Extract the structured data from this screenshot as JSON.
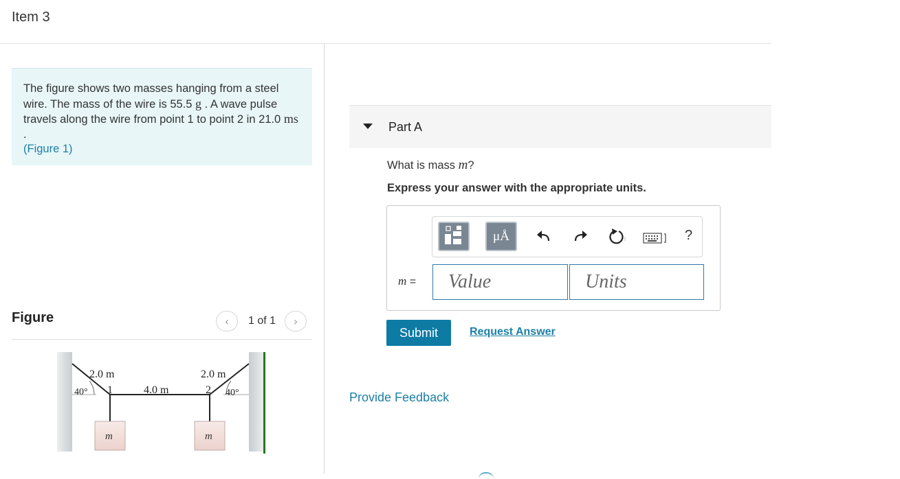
{
  "item": {
    "title": "Item 3"
  },
  "problem": {
    "text_before": "The figure shows two masses hanging from a steel wire. The mass of the wire is 55.5 ",
    "mass_unit": "g",
    "text_middle": " . A wave pulse travels along the wire from point 1 to point 2 in 21.0 ",
    "time_unit": "ms",
    "text_after": " .",
    "figure_link": "(Figure 1)"
  },
  "figure": {
    "label": "Figure",
    "pager_text": "1 of 1",
    "prev_icon": "chevron-left-icon",
    "next_icon": "chevron-right-icon",
    "diagram": {
      "left_segment": "2.0 m",
      "middle_segment": "4.0 m",
      "right_segment": "2.0 m",
      "left_angle": "40°",
      "right_angle": "40°",
      "point_1": "1",
      "point_2": "2",
      "mass_left": "m",
      "mass_right": "m"
    }
  },
  "part": {
    "title": "Part A",
    "question_before": "What is mass ",
    "question_var": "m",
    "question_after": "?",
    "instruction": "Express your answer with the appropriate units.",
    "toolbar": {
      "templates_icon": "templates-icon",
      "units_button_label": "μÅ",
      "undo_icon": "undo-icon",
      "redo_icon": "redo-icon",
      "reset_icon": "reset-icon",
      "keyboard_icon": "keyboard-icon",
      "help_label": "?"
    },
    "variable": "m",
    "equals": " =",
    "value_placeholder": "Value",
    "units_placeholder": "Units",
    "submit_label": "Submit",
    "request_answer_label": "Request Answer"
  },
  "feedback": {
    "label": "Provide Feedback"
  },
  "colors": {
    "accent": "#0d7ba4",
    "link": "#1c7fa6",
    "problem_bg": "#e8f6f7",
    "toolbar_button": "#7a8793"
  }
}
